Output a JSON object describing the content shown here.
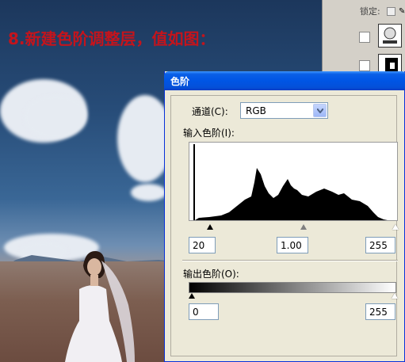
{
  "caption": "8.新建色阶调整层，值如图：",
  "panel": {
    "lock_label": "锁定:"
  },
  "dialog": {
    "title": "色阶",
    "channel_label": "通道(C):",
    "channel_value": "RGB",
    "input_levels_label": "输入色阶(I):",
    "input_black": "20",
    "input_gamma": "1.00",
    "input_white": "255",
    "output_levels_label": "输出色阶(O):",
    "output_black": "0",
    "output_white": "255"
  },
  "colors": {
    "caption": "#c4141c",
    "titlebar": "#0055e5",
    "dialog_bg": "#ece9d8"
  }
}
